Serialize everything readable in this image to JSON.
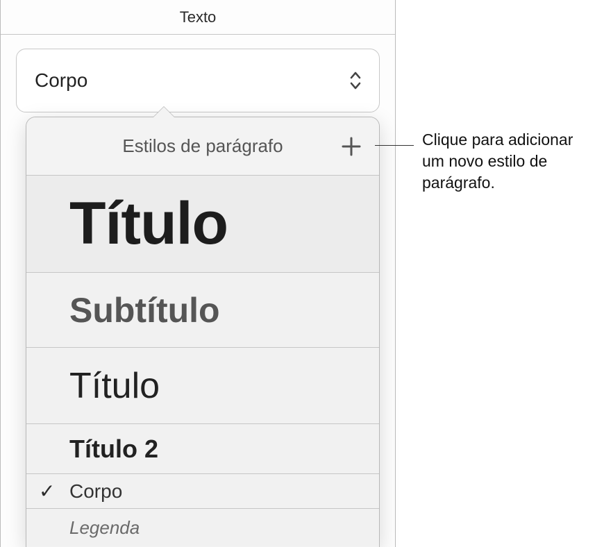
{
  "tab": {
    "label": "Texto"
  },
  "select": {
    "value": "Corpo"
  },
  "popover": {
    "title": "Estilos de parágrafo",
    "styles": {
      "titulo_big": "Título",
      "subtitulo": "Subtítulo",
      "titulo": "Título",
      "titulo2": "Título 2",
      "corpo": "Corpo",
      "legenda": "Legenda"
    },
    "checkmark": "✓"
  },
  "callout": {
    "text": "Clique para adicionar um novo estilo de parágrafo."
  }
}
